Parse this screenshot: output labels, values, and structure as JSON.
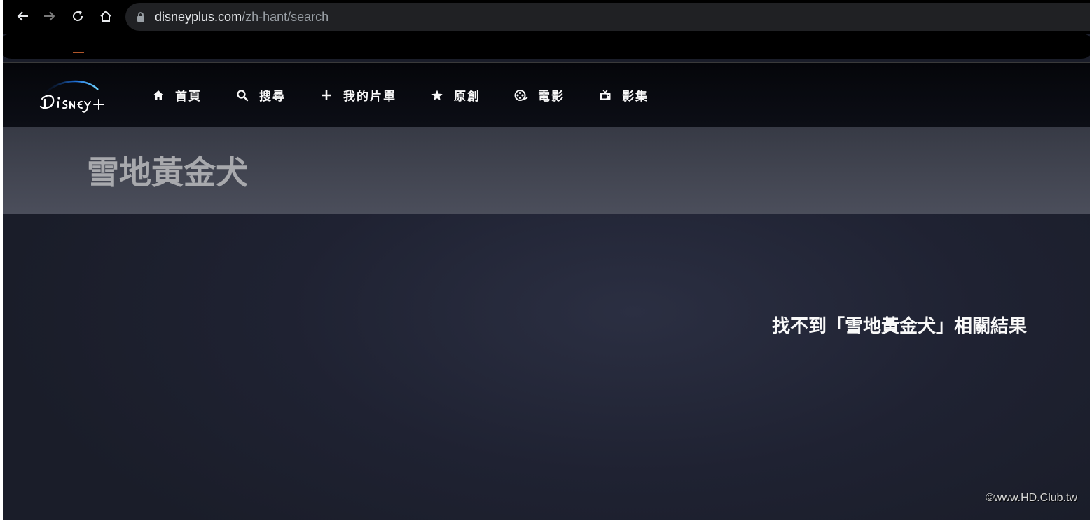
{
  "browser": {
    "url_domain": "disneyplus.com",
    "url_path": "/zh-hant/search"
  },
  "nav": {
    "items": [
      {
        "label": "首頁",
        "icon": "home-icon"
      },
      {
        "label": "搜尋",
        "icon": "search-icon"
      },
      {
        "label": "我的片單",
        "icon": "plus-icon"
      },
      {
        "label": "原創",
        "icon": "star-icon"
      },
      {
        "label": "電影",
        "icon": "film-reel-icon"
      },
      {
        "label": "影集",
        "icon": "tv-icon"
      }
    ]
  },
  "search": {
    "query": "雪地黃金犬"
  },
  "results": {
    "no_results_message": "找不到「雪地黃金犬」相關結果"
  },
  "watermark": "©www.HD.Club.tw",
  "colors": {
    "background": "#1a1d29",
    "header": "#0c0e16",
    "search_banner": "#4b4e5b",
    "text": "#f9f9f9",
    "logo_arc": "#2f8cff"
  }
}
